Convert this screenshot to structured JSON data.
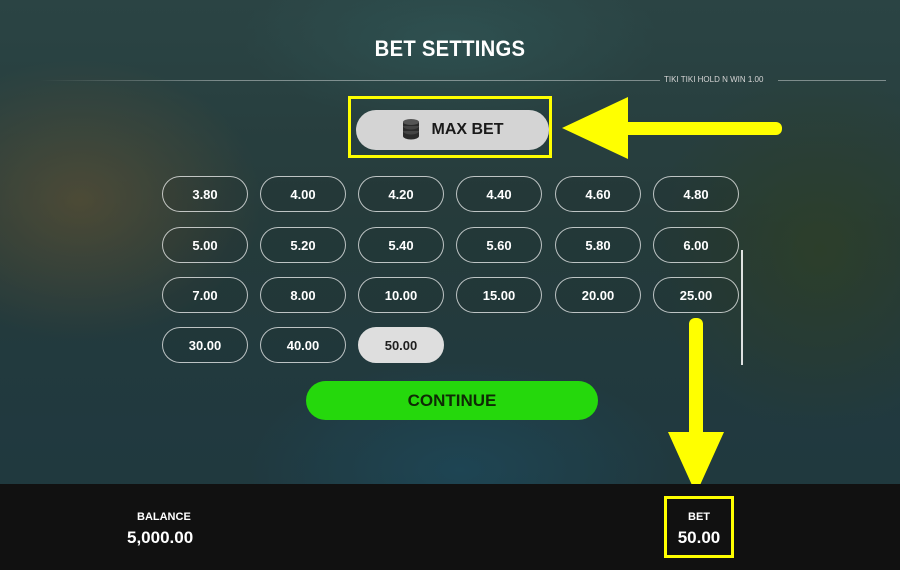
{
  "screen": {
    "title": "BET SETTINGS",
    "version": "TIKI TIKI HOLD N WIN 1.00"
  },
  "max_bet": {
    "label": "MAX BET",
    "icon": "coin-stack-icon"
  },
  "bets": {
    "options": [
      "3.80",
      "4.00",
      "4.20",
      "4.40",
      "4.60",
      "4.80",
      "5.00",
      "5.20",
      "5.40",
      "5.60",
      "5.80",
      "6.00",
      "7.00",
      "8.00",
      "10.00",
      "15.00",
      "20.00",
      "25.00",
      "30.00",
      "40.00",
      "50.00"
    ],
    "selected": "50.00"
  },
  "continue": {
    "label": "CONTINUE"
  },
  "footer": {
    "balance_label": "BALANCE",
    "balance_value": "5,000.00",
    "bet_label": "BET",
    "bet_value": "50.00"
  },
  "colors": {
    "highlight": "#ffff00",
    "continue": "#25d80c",
    "selected": "#dedede"
  }
}
